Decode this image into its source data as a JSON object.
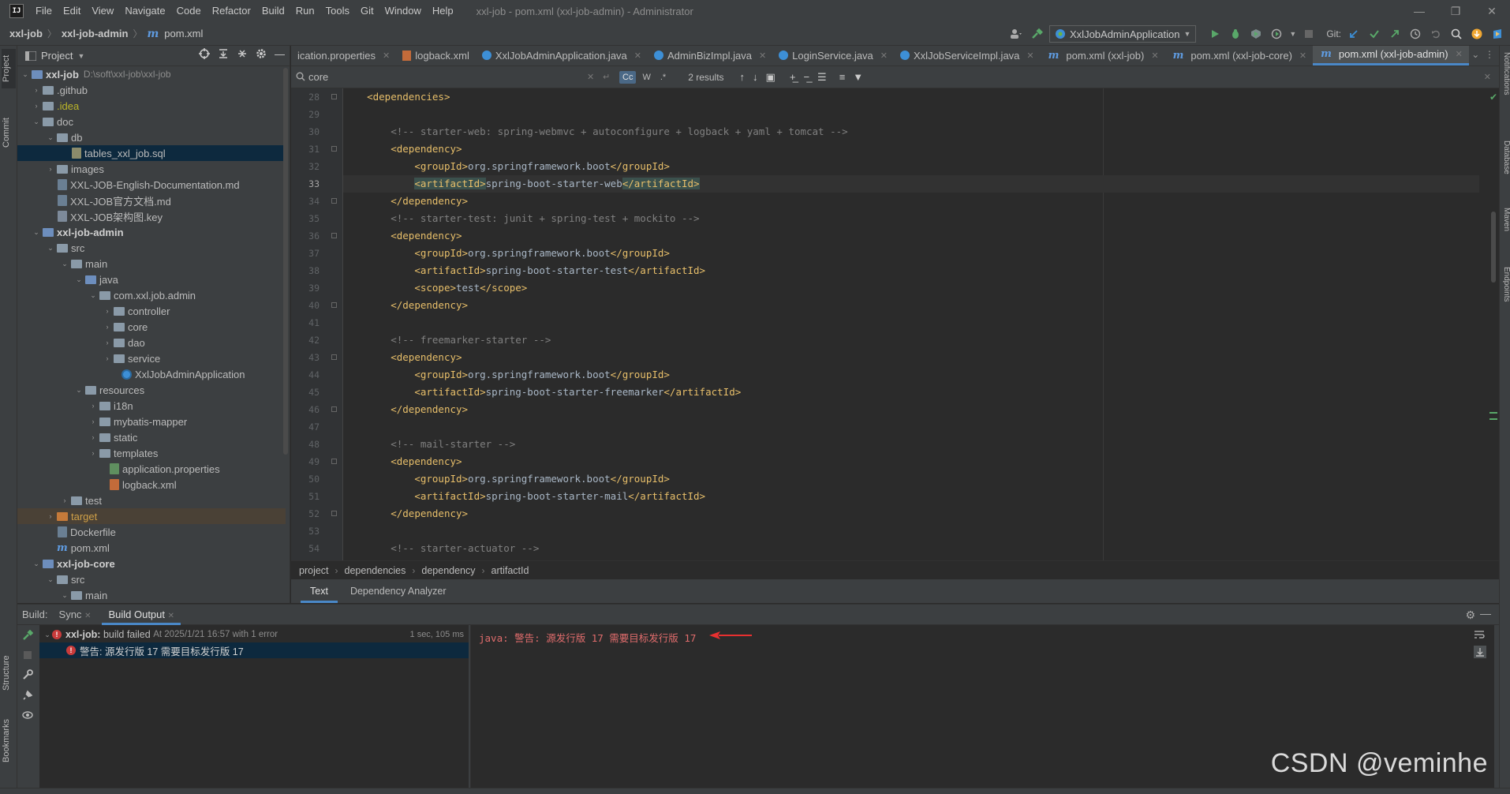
{
  "menu": [
    "File",
    "Edit",
    "View",
    "Navigate",
    "Code",
    "Refactor",
    "Build",
    "Run",
    "Tools",
    "Git",
    "Window",
    "Help"
  ],
  "window_title": "xxl-job - pom.xml (xxl-job-admin) - Administrator",
  "navbar": {
    "crumb1": "xxl-job",
    "crumb2": "xxl-job-admin",
    "crumb3": "pom.xml",
    "run_config": "XxlJobAdminApplication",
    "git_label": "Git:"
  },
  "left_strip": {
    "project": "Project",
    "commit": "Commit",
    "structure": "Structure",
    "bookmarks": "Bookmarks"
  },
  "right_strip": {
    "notifications": "Notifications",
    "database": "Database",
    "maven": "Maven",
    "endpoints": "Endpoints"
  },
  "project": {
    "title": "Project",
    "tree": [
      {
        "label": "xxl-job",
        "path": "D:\\soft\\xxl-job\\xxl-job"
      },
      {
        "label": ".github"
      },
      {
        "label": ".idea"
      },
      {
        "label": "doc"
      },
      {
        "label": "db"
      },
      {
        "label": "tables_xxl_job.sql"
      },
      {
        "label": "images"
      },
      {
        "label": "XXL-JOB-English-Documentation.md"
      },
      {
        "label": "XXL-JOB官方文档.md"
      },
      {
        "label": "XXL-JOB架构图.key"
      },
      {
        "label": "xxl-job-admin"
      },
      {
        "label": "src"
      },
      {
        "label": "main"
      },
      {
        "label": "java"
      },
      {
        "label": "com.xxl.job.admin"
      },
      {
        "label": "controller"
      },
      {
        "label": "core"
      },
      {
        "label": "dao"
      },
      {
        "label": "service"
      },
      {
        "label": "XxlJobAdminApplication"
      },
      {
        "label": "resources"
      },
      {
        "label": "i18n"
      },
      {
        "label": "mybatis-mapper"
      },
      {
        "label": "static"
      },
      {
        "label": "templates"
      },
      {
        "label": "application.properties"
      },
      {
        "label": "logback.xml"
      },
      {
        "label": "test"
      },
      {
        "label": "target"
      },
      {
        "label": "Dockerfile"
      },
      {
        "label": "pom.xml"
      },
      {
        "label": "xxl-job-core"
      },
      {
        "label": "src"
      },
      {
        "label": "main"
      }
    ]
  },
  "tabs": [
    "ication.properties",
    "logback.xml",
    "XxlJobAdminApplication.java",
    "AdminBizImpl.java",
    "LoginService.java",
    "XxlJobServiceImpl.java",
    "pom.xml (xxl-job)",
    "pom.xml (xxl-job-core)",
    "pom.xml (xxl-job-admin)"
  ],
  "find": {
    "query": "core",
    "opt_cc": "Cc",
    "opt_w": "W",
    "opt_re": ".*",
    "results": "2 results"
  },
  "code": {
    "line_numbers": [
      "28",
      "29",
      "30",
      "31",
      "32",
      "33",
      "34",
      "35",
      "36",
      "37",
      "38",
      "39",
      "40",
      "41",
      "42",
      "43",
      "44",
      "45",
      "46",
      "47",
      "48",
      "49",
      "50",
      "51",
      "52",
      "53",
      "54"
    ],
    "lines": [
      "    <dependencies>",
      "",
      "        <!-- starter-web: spring-webmvc + autoconfigure + logback + yaml + tomcat -->",
      "        <dependency>",
      "            <groupId>org.springframework.boot</groupId>",
      "            <artifactId>spring-boot-starter-web</artifactId>",
      "        </dependency>",
      "        <!-- starter-test: junit + spring-test + mockito -->",
      "        <dependency>",
      "            <groupId>org.springframework.boot</groupId>",
      "            <artifactId>spring-boot-starter-test</artifactId>",
      "            <scope>test</scope>",
      "        </dependency>",
      "",
      "        <!-- freemarker-starter -->",
      "        <dependency>",
      "            <groupId>org.springframework.boot</groupId>",
      "            <artifactId>spring-boot-starter-freemarker</artifactId>",
      "        </dependency>",
      "",
      "        <!-- mail-starter -->",
      "        <dependency>",
      "            <groupId>org.springframework.boot</groupId>",
      "            <artifactId>spring-boot-starter-mail</artifactId>",
      "        </dependency>",
      "",
      "        <!-- starter-actuator -->"
    ]
  },
  "breadcrumb": [
    "project",
    "dependencies",
    "dependency",
    "artifactId"
  ],
  "bottom_tabs": [
    "Text",
    "Dependency Analyzer"
  ],
  "build": {
    "label": "Build:",
    "tabs": [
      "Sync",
      "Build Output"
    ],
    "row1_name": "xxl-job:",
    "row1_text": "build failed",
    "row1_at": "At 2025/1/21 16:57 with 1 error",
    "row1_time": "1 sec, 105 ms",
    "row2": "警告: 源发行版 17 需要目标发行版 17",
    "console": "java: 警告: 源发行版 17 需要目标发行版 17"
  },
  "watermark": "CSDN @veminhe",
  "colors": {
    "accent": "#4a88c7",
    "error": "#e06c6c",
    "tag": "#e8bf6a",
    "comment": "#808080"
  }
}
